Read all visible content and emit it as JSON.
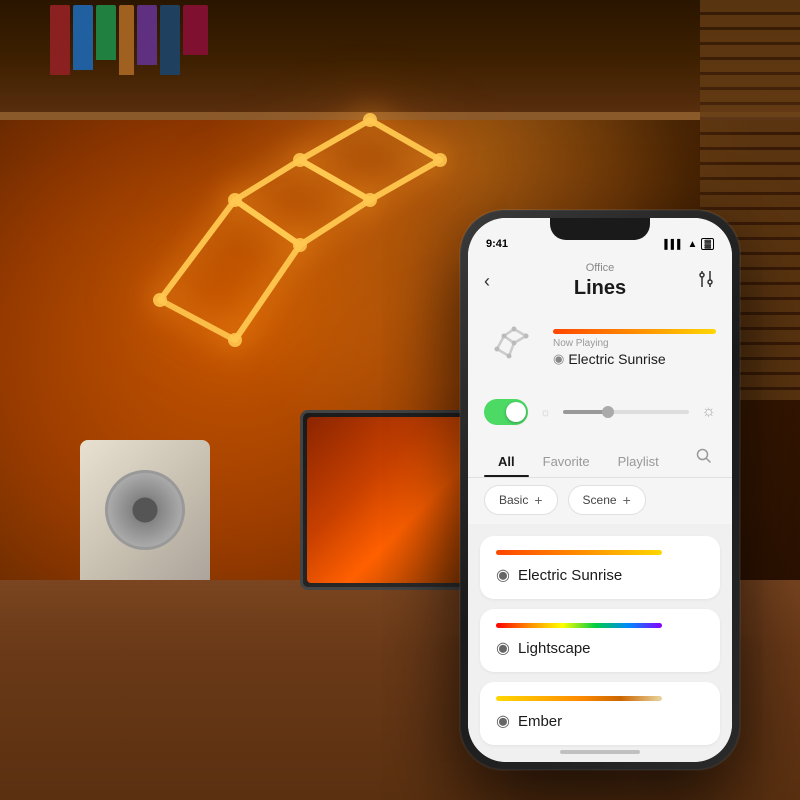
{
  "background": {
    "colors": [
      "#c85a00",
      "#8b3500",
      "#3d1a00",
      "#1a0800"
    ]
  },
  "status_bar": {
    "time": "9:41",
    "signal": "▌▌▌",
    "wifi": "▲",
    "battery": "▓"
  },
  "header": {
    "back_label": "‹",
    "subtitle": "Office",
    "title": "Lines",
    "settings_label": "⊞"
  },
  "now_playing": {
    "label": "Now Playing",
    "effect": "Electric Sunrise",
    "drop_icon": "◉"
  },
  "controls": {
    "toggle_on": true,
    "brightness_icon_low": "☼",
    "brightness_icon_high": "☼"
  },
  "tabs": [
    {
      "id": "all",
      "label": "All",
      "active": true
    },
    {
      "id": "favorite",
      "label": "Favorite",
      "active": false
    },
    {
      "id": "playlist",
      "label": "Playlist",
      "active": false
    }
  ],
  "tab_search_icon": "🔍",
  "categories": [
    {
      "id": "basic",
      "label": "Basic",
      "plus": "+"
    },
    {
      "id": "scene",
      "label": "Scene",
      "plus": "+"
    }
  ],
  "scenes": [
    {
      "id": "electric-sunrise",
      "name": "Electric Sunrise",
      "bar_class": "bar-electric",
      "drop_icon": "◉"
    },
    {
      "id": "lightscape",
      "name": "Lightscape",
      "bar_class": "bar-lightscape",
      "drop_icon": "◉"
    },
    {
      "id": "ember",
      "name": "Ember",
      "bar_class": "bar-ember",
      "drop_icon": "◉"
    }
  ],
  "books": [
    {
      "color": "#8b2020"
    },
    {
      "color": "#2060a0"
    },
    {
      "color": "#208040"
    },
    {
      "color": "#a06020"
    },
    {
      "color": "#603080"
    },
    {
      "color": "#204060"
    },
    {
      "color": "#801030"
    }
  ]
}
